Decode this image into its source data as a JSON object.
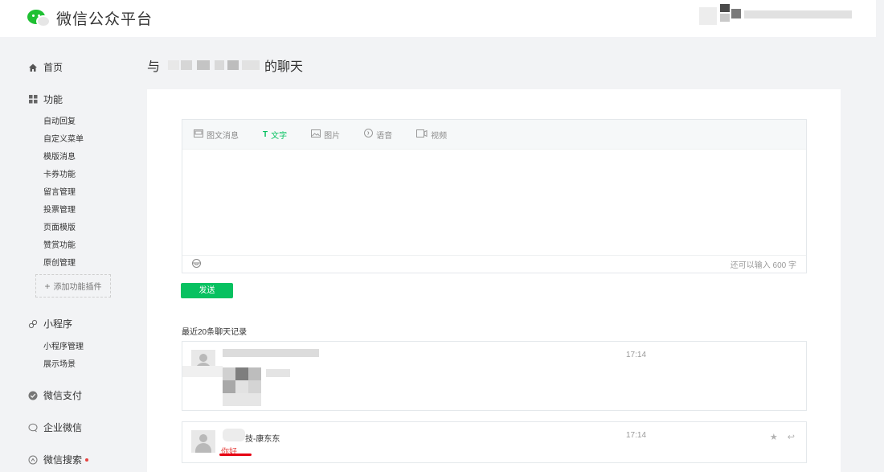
{
  "header": {
    "brand_title": "微信公众平台",
    "logo_icon": "wechat-logo-icon"
  },
  "sidebar": {
    "home": {
      "label": "首页",
      "icon": "home-icon"
    },
    "features": {
      "label": "功能",
      "icon": "grid-icon",
      "items": [
        "自动回复",
        "自定义菜单",
        "模版消息",
        "卡券功能",
        "留言管理",
        "投票管理",
        "页面模版",
        "赞赏功能",
        "原创管理"
      ],
      "add_plugin": "添加功能插件"
    },
    "miniprogram": {
      "label": "小程序",
      "icon": "link-icon",
      "items": [
        "小程序管理",
        "展示场景"
      ]
    },
    "wechat_pay": {
      "label": "微信支付",
      "icon": "pay-icon"
    },
    "work_wechat": {
      "label": "企业微信",
      "icon": "chat-icon"
    },
    "wechat_search": {
      "label": "微信搜索",
      "icon": "search-icon"
    }
  },
  "main": {
    "title_prefix": "与",
    "title_suffix": "的聊天",
    "editor": {
      "tabs": [
        {
          "label": "图文消息",
          "icon": "news-icon",
          "active": false
        },
        {
          "label": "文字",
          "icon": "text-icon",
          "active": true
        },
        {
          "label": "图片",
          "icon": "image-icon",
          "active": false
        },
        {
          "label": "语音",
          "icon": "voice-icon",
          "active": false
        },
        {
          "label": "视频",
          "icon": "video-icon",
          "active": false
        }
      ],
      "emoji_icon": "emoji-icon",
      "char_count": "还可以输入 600 字"
    },
    "send_label": "发送",
    "history_title": "最近20条聊天记录",
    "messages": [
      {
        "time": "17:14",
        "name": "",
        "text": ""
      },
      {
        "time": "17:14",
        "name": "技-康东东",
        "text": "你好"
      }
    ]
  },
  "colors": {
    "accent": "#07c160",
    "brand_green": "#1fc033",
    "alert_red": "#e64340",
    "background": "#f2f3f5"
  }
}
